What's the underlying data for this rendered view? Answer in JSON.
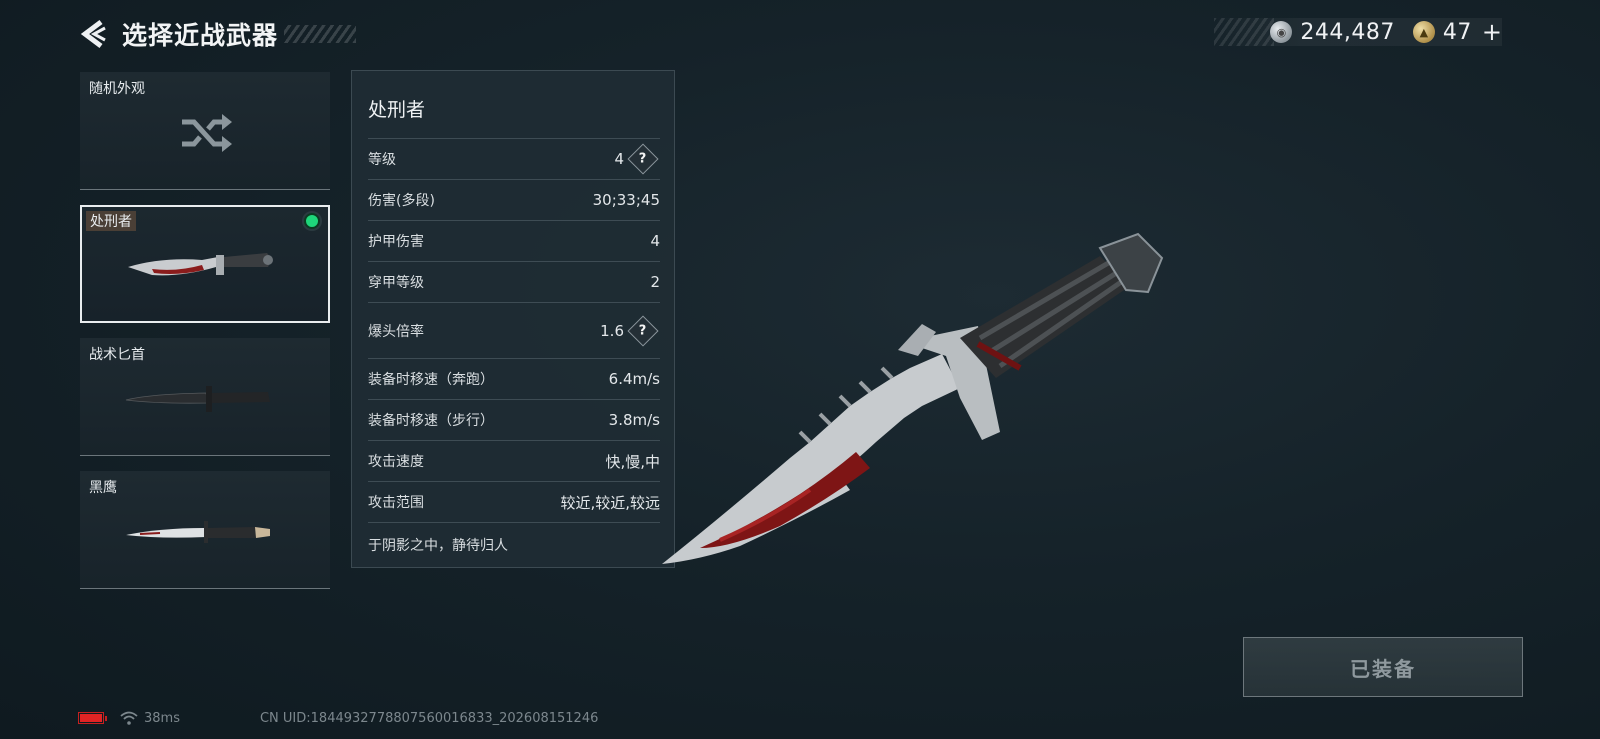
{
  "header": {
    "title": "选择近战武器",
    "silver_amount": "244,487",
    "gold_amount": "47",
    "add_label": "+"
  },
  "weapons": [
    {
      "label": "随机外观",
      "icon": "shuffle-icon",
      "selected": false
    },
    {
      "label": "处刑者",
      "icon": "executioner-knife",
      "selected": true,
      "equipped": true
    },
    {
      "label": "战术匕首",
      "icon": "tactical-dagger",
      "selected": false
    },
    {
      "label": "黑鹰",
      "icon": "black-hawk-knife",
      "selected": false
    }
  ],
  "stats": {
    "name": "处刑者",
    "rows": [
      {
        "label": "等级",
        "value": "4",
        "help": true
      },
      {
        "label": "伤害(多段)",
        "value": "30;33;45"
      },
      {
        "label": "护甲伤害",
        "value": "4"
      },
      {
        "label": "穿甲等级",
        "value": "2"
      },
      {
        "label": "爆头倍率",
        "value": "1.6",
        "help": true
      },
      {
        "label": "装备时移速（奔跑）",
        "value": "6.4m/s"
      },
      {
        "label": "装备时移速（步行）",
        "value": "3.8m/s"
      },
      {
        "label": "攻击速度",
        "value": "快,慢,中"
      },
      {
        "label": "攻击范围",
        "value": "较近,较近,较远"
      }
    ],
    "description": "于阴影之中，静待归人",
    "help_glyph": "?"
  },
  "equip_button": "已装备",
  "footer": {
    "ping": "38ms",
    "uid": "CN UID:1844932778807560016833_202608151246"
  },
  "colors": {
    "equipped_dot": "#1ed67a",
    "battery_low": "#e02424"
  }
}
